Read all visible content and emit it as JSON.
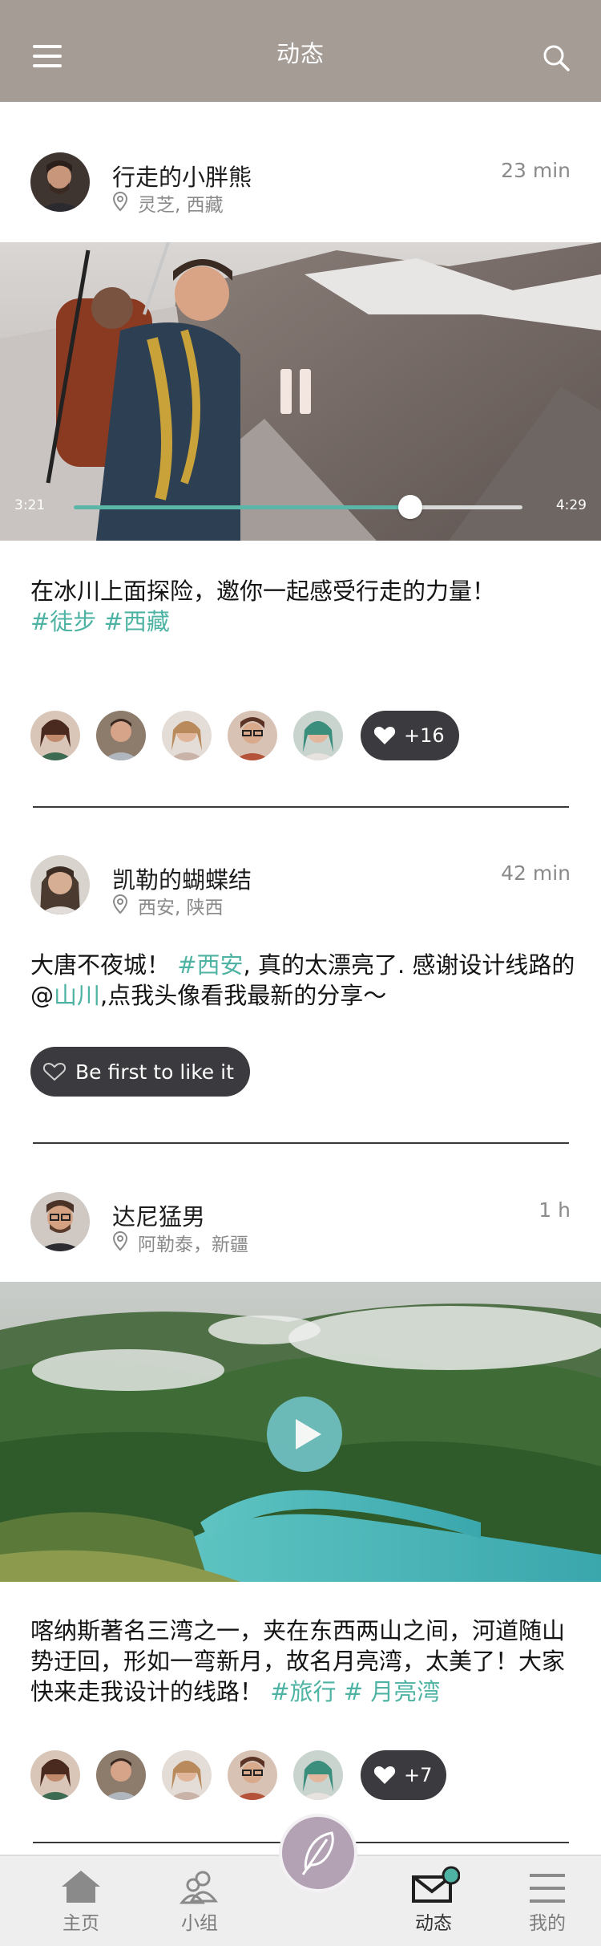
{
  "header": {
    "title": "动态",
    "menu_icon": "menu-icon",
    "search_icon": "search-icon",
    "bg_color": "#a59c96"
  },
  "posts": [
    {
      "author": "行走的小胖熊",
      "location": "灵芝, 西藏",
      "time": "23 min",
      "video": {
        "elapsed": "3:21",
        "duration": "4:29",
        "progress": 0.75,
        "state": "playing"
      },
      "text": "在冰川上面探险，邀你一起感受行走的力量！",
      "tags": [
        "#徒步",
        "#西藏"
      ],
      "likes": "+16"
    },
    {
      "author": "凯勒的蝴蝶结",
      "location": "西安, 陕西",
      "time": "42 min",
      "text_parts": {
        "p1": "大唐不夜城！ ",
        "tag1": "#西安",
        "p2": ", 真的太漂亮了. 感谢设计线路的@",
        "mention": "山川",
        "p3": ",点我头像看我最新的分享～"
      },
      "like_button": "Be first to like it"
    },
    {
      "author": "达尼猛男",
      "location": "阿勒泰，新疆",
      "time": "1 h",
      "video": {
        "state": "paused"
      },
      "text": "喀纳斯著名三湾之一，夹在东西两山之间，河道随山势迂回，形如一弯新月，故名月亮湾，太美了！大家快来走我设计的线路！",
      "tags": [
        "#旅行",
        "# 月亮湾"
      ],
      "likes": "+7"
    }
  ],
  "tabs": [
    {
      "label": "主页",
      "icon": "home-icon"
    },
    {
      "label": "小组",
      "icon": "group-icon"
    },
    {
      "label": "动态",
      "icon": "mail-icon",
      "active": true
    },
    {
      "label": "我的",
      "icon": "list-icon"
    }
  ],
  "compose_icon": "feather-icon",
  "colors": {
    "accent": "#4eb3a3",
    "pill": "#3b3b3f",
    "compose": "#b3a2b4"
  }
}
